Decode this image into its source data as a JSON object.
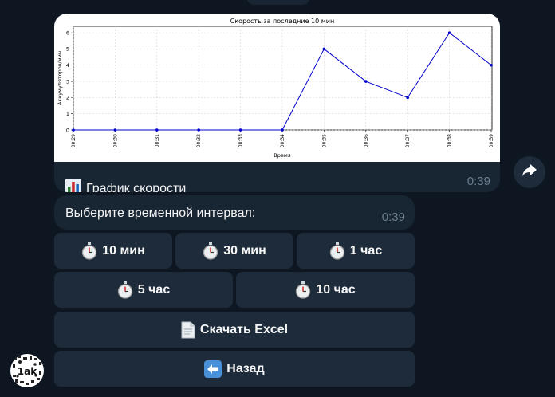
{
  "chart_message": {
    "caption": "График скорости",
    "time": "0:39",
    "caption_icon": "bar-chart-icon"
  },
  "interval_message": {
    "text": "Выберите временной интервал:",
    "time": "0:39"
  },
  "keyboard": {
    "buttons": [
      {
        "label": "10 мин",
        "icon": "stopwatch-icon"
      },
      {
        "label": "30 мин",
        "icon": "stopwatch-icon"
      },
      {
        "label": "1 час",
        "icon": "stopwatch-icon"
      },
      {
        "label": "5 час",
        "icon": "stopwatch-icon"
      },
      {
        "label": "10 час",
        "icon": "stopwatch-icon"
      },
      {
        "label": "Скачать Excel",
        "icon": "document-icon"
      },
      {
        "label": "Назад",
        "icon": "back-arrow-icon"
      }
    ]
  },
  "avatar": {
    "text": "1ak"
  },
  "colors": {
    "background": "#0e1621",
    "bubble": "#182533",
    "button": "#1d2b3a",
    "line": "#0000cc",
    "timestamp": "#6d7f8f"
  },
  "chart_data": {
    "type": "line",
    "title": "Скорость за последние 10 мин",
    "xlabel": "Время",
    "ylabel": "Аккумуляторов/мин",
    "x": [
      "00:29",
      "00:30",
      "00:31",
      "00:32",
      "00:33",
      "00:34",
      "00:35",
      "00:36",
      "00:37",
      "00:38",
      "00:39"
    ],
    "yticks": [
      0,
      1,
      2,
      3,
      4,
      5,
      6
    ],
    "ylim": [
      0,
      6.4
    ],
    "grid": true,
    "series": [
      {
        "values": [
          0,
          0,
          0,
          0,
          0,
          0,
          5,
          3,
          2,
          6,
          4
        ]
      }
    ]
  }
}
